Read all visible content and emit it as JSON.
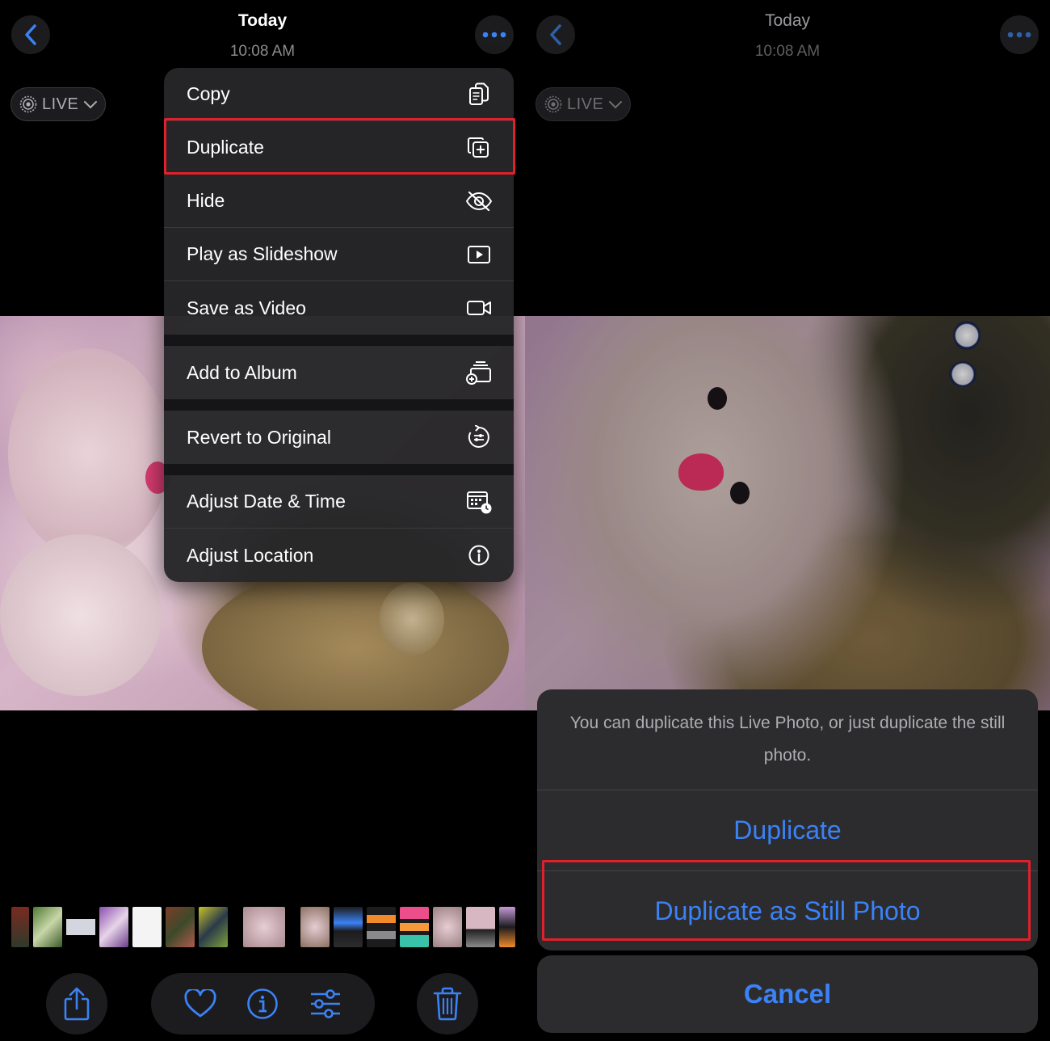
{
  "left": {
    "header": {
      "title": "Today",
      "time": "10:08 AM"
    },
    "live_badge": {
      "label": "LIVE"
    },
    "menu": {
      "items": [
        {
          "label": "Copy",
          "icon": "copy-icon"
        },
        {
          "label": "Duplicate",
          "icon": "duplicate-icon"
        },
        {
          "label": "Hide",
          "icon": "eye-slash-icon"
        },
        {
          "label": "Play as Slideshow",
          "icon": "play-rectangle-icon"
        },
        {
          "label": "Save as Video",
          "icon": "video-camera-icon"
        },
        {
          "label": "Add to Album",
          "icon": "add-to-album-icon"
        },
        {
          "label": "Revert to Original",
          "icon": "revert-icon"
        },
        {
          "label": "Adjust Date & Time",
          "icon": "calendar-clock-icon"
        },
        {
          "label": "Adjust Location",
          "icon": "location-info-icon"
        }
      ],
      "highlighted": "Duplicate"
    },
    "toolbar": [
      "share-icon",
      "heart-icon",
      "info-icon",
      "sliders-icon",
      "trash-icon"
    ]
  },
  "right": {
    "header": {
      "title": "Today",
      "time": "10:08 AM"
    },
    "live_badge": {
      "label": "LIVE"
    },
    "sheet": {
      "message": "You can duplicate this Live Photo, or just duplicate the still photo.",
      "duplicate_label": "Duplicate",
      "duplicate_still_label": "Duplicate as Still Photo",
      "cancel_label": "Cancel",
      "highlighted": "Duplicate as Still Photo"
    }
  },
  "colors": {
    "accent": "#3b82f6",
    "highlight": "#e0202a",
    "menu_bg": "#262628"
  }
}
